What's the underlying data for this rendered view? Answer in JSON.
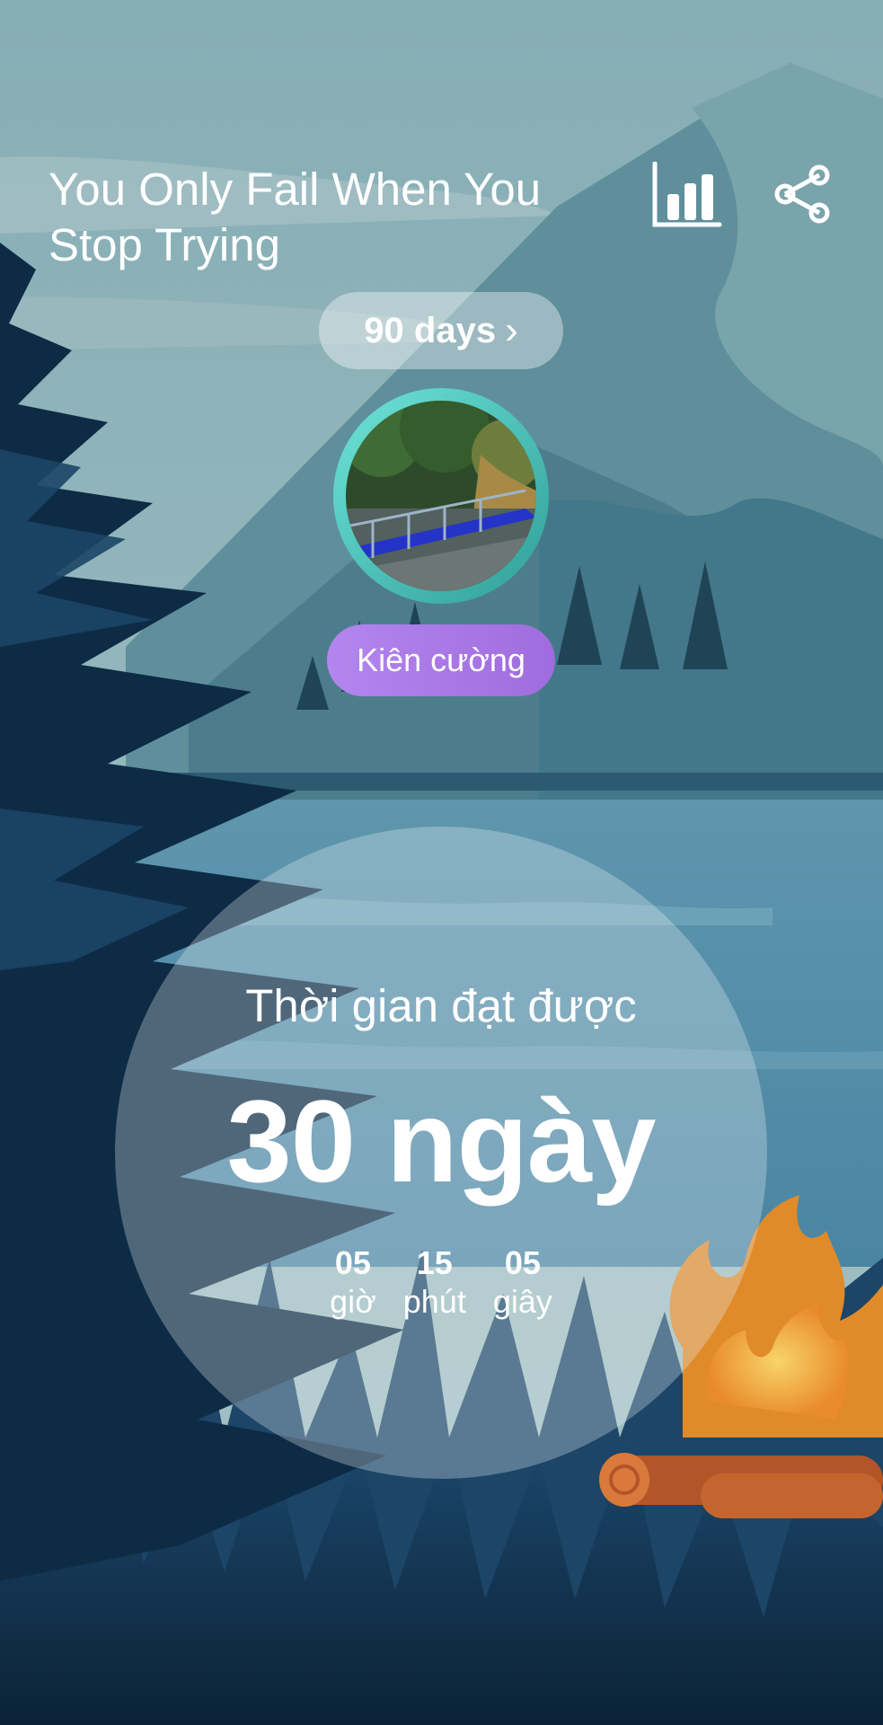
{
  "header": {
    "title": "You Only Fail When You Stop Trying",
    "stats_icon": "bar-chart-icon",
    "share_icon": "share-icon"
  },
  "goal_pill": {
    "label": "90 days",
    "chevron": "›"
  },
  "avatar": {
    "description_icon": "photo-avatar"
  },
  "rank_badge": {
    "label": "Kiên cường"
  },
  "progress": {
    "label": "Thời gian đạt được",
    "value": "30 ngày",
    "hours": "05",
    "hours_label": "giờ",
    "minutes": "15",
    "minutes_label": "phút",
    "seconds": "05",
    "seconds_label": "giây"
  },
  "colors": {
    "rank_badge": "#a878e6",
    "avatar_ring": "#4fc9c0",
    "fire": "#f0a23a"
  }
}
